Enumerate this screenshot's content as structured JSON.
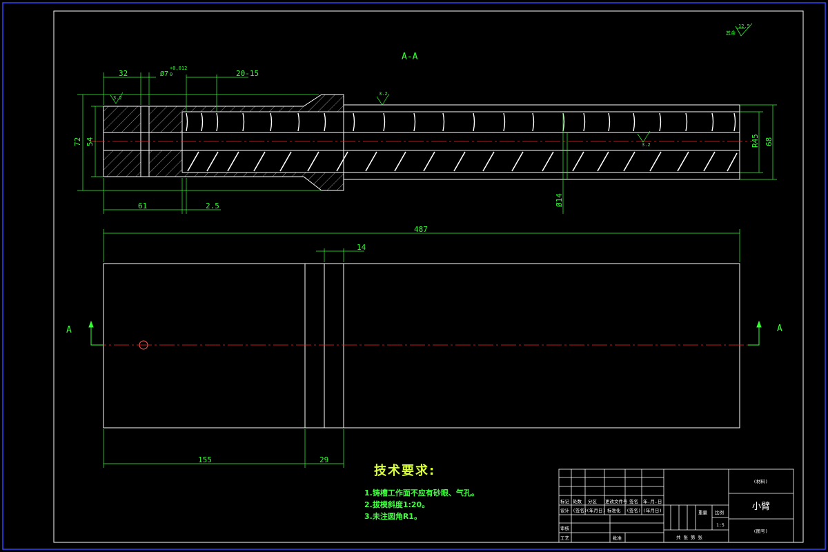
{
  "section_label": "A-A",
  "section_markers": {
    "left": "A",
    "right": "A"
  },
  "dimensions": {
    "d32": "32",
    "dphi7": "Ø7",
    "dphi7_tol_upper": "+0.012",
    "dphi7_tol_lower": "0",
    "d20_15": "20-15",
    "d61": "61",
    "d2_5": "2.5",
    "d72": "72",
    "d54": "54",
    "d14": "Ø14",
    "d45": "R45",
    "d68": "68",
    "d487": "487",
    "d14_top": "14",
    "d155": "155",
    "d29": "29"
  },
  "roughness": {
    "left": "3.2",
    "shoulder": "3.2",
    "bore": "3.2",
    "corner_value": "12.5",
    "corner_label": "其余"
  },
  "technical_requirements": {
    "title": "技术要求:",
    "items": [
      "1.铸槽工作面不应有砂眼、气孔。",
      "2.拔模斜度1:20。",
      "3.未注圆角R1。"
    ]
  },
  "title_block": {
    "material": "(材料)",
    "part_name": "小臂",
    "drawing_no": "(图号)",
    "scale_label": "比例",
    "scale_value": "1:5",
    "weight_label": "重量",
    "sheets": "共  张  第  张",
    "rows": {
      "r1": [
        "标记",
        "处数",
        "分区",
        "更改文件号",
        "签名",
        "年.月.日"
      ],
      "r2": [
        "设计",
        "(签名)",
        "(年月日)",
        "标准化",
        "(签名)",
        "(年月日)"
      ],
      "r3": [
        "审核"
      ],
      "r4": [
        "工艺",
        "批准"
      ]
    }
  },
  "colors": {
    "border": "#3344ff",
    "outline": "#ffffff",
    "dimension": "#33ff33",
    "centerline": "#ff2222",
    "hatch": "#ffffff",
    "title": "#d9ff3d"
  }
}
